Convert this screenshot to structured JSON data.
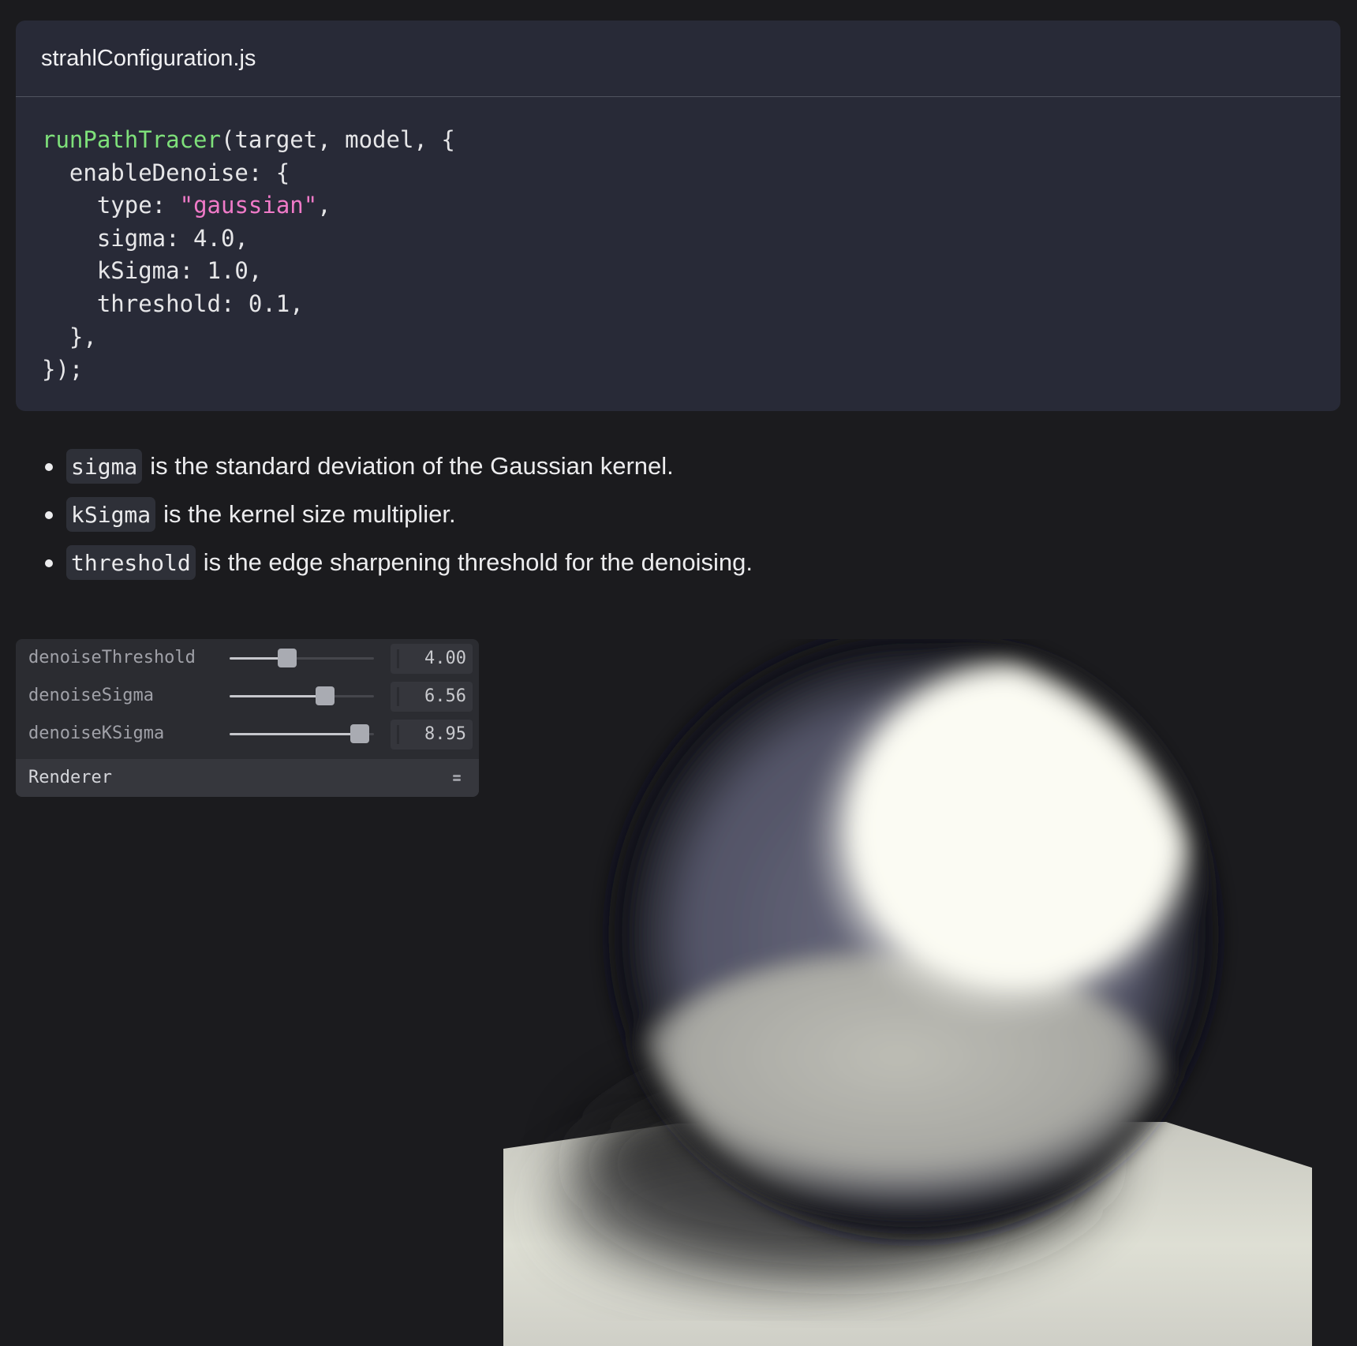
{
  "code_block": {
    "filename": "strahlConfiguration.js",
    "lines": [
      [
        {
          "t": "runPathTracer",
          "k": "fn"
        },
        {
          "t": "(target, model, {",
          "k": "plain"
        }
      ],
      [
        {
          "t": "  enableDenoise: {",
          "k": "plain"
        }
      ],
      [
        {
          "t": "    type: ",
          "k": "plain"
        },
        {
          "t": "\"gaussian\"",
          "k": "str"
        },
        {
          "t": ",",
          "k": "plain"
        }
      ],
      [
        {
          "t": "    sigma: 4.0,",
          "k": "plain"
        }
      ],
      [
        {
          "t": "    kSigma: 1.0,",
          "k": "plain"
        }
      ],
      [
        {
          "t": "    threshold: 0.1,",
          "k": "plain"
        }
      ],
      [
        {
          "t": "  },",
          "k": "plain"
        }
      ],
      [
        {
          "t": "});",
          "k": "plain"
        }
      ]
    ]
  },
  "bullets": [
    {
      "code": "sigma",
      "text": "is the standard deviation of the Gaussian kernel."
    },
    {
      "code": "kSigma",
      "text": "is the kernel size multiplier."
    },
    {
      "code": "threshold",
      "text": "is the edge sharpening threshold for the denoising."
    }
  ],
  "controls": {
    "sliders": [
      {
        "label": "denoiseThreshold",
        "value": "4.00",
        "fraction": 0.4
      },
      {
        "label": "denoiseSigma",
        "value": "6.56",
        "fraction": 0.66
      },
      {
        "label": "denoiseKSigma",
        "value": "8.95",
        "fraction": 0.9
      }
    ],
    "folder_title": "Renderer",
    "folder_icon": "collapse-icon"
  },
  "render": {
    "colors": {
      "background": "#1b1b1e",
      "floor": "#dcdcd2",
      "sphere_highlight": "#fbfbf3",
      "sphere_body": "#55566a"
    }
  },
  "colors": {
    "function_token": "#7ee07a",
    "string_token": "#f07ac8"
  }
}
